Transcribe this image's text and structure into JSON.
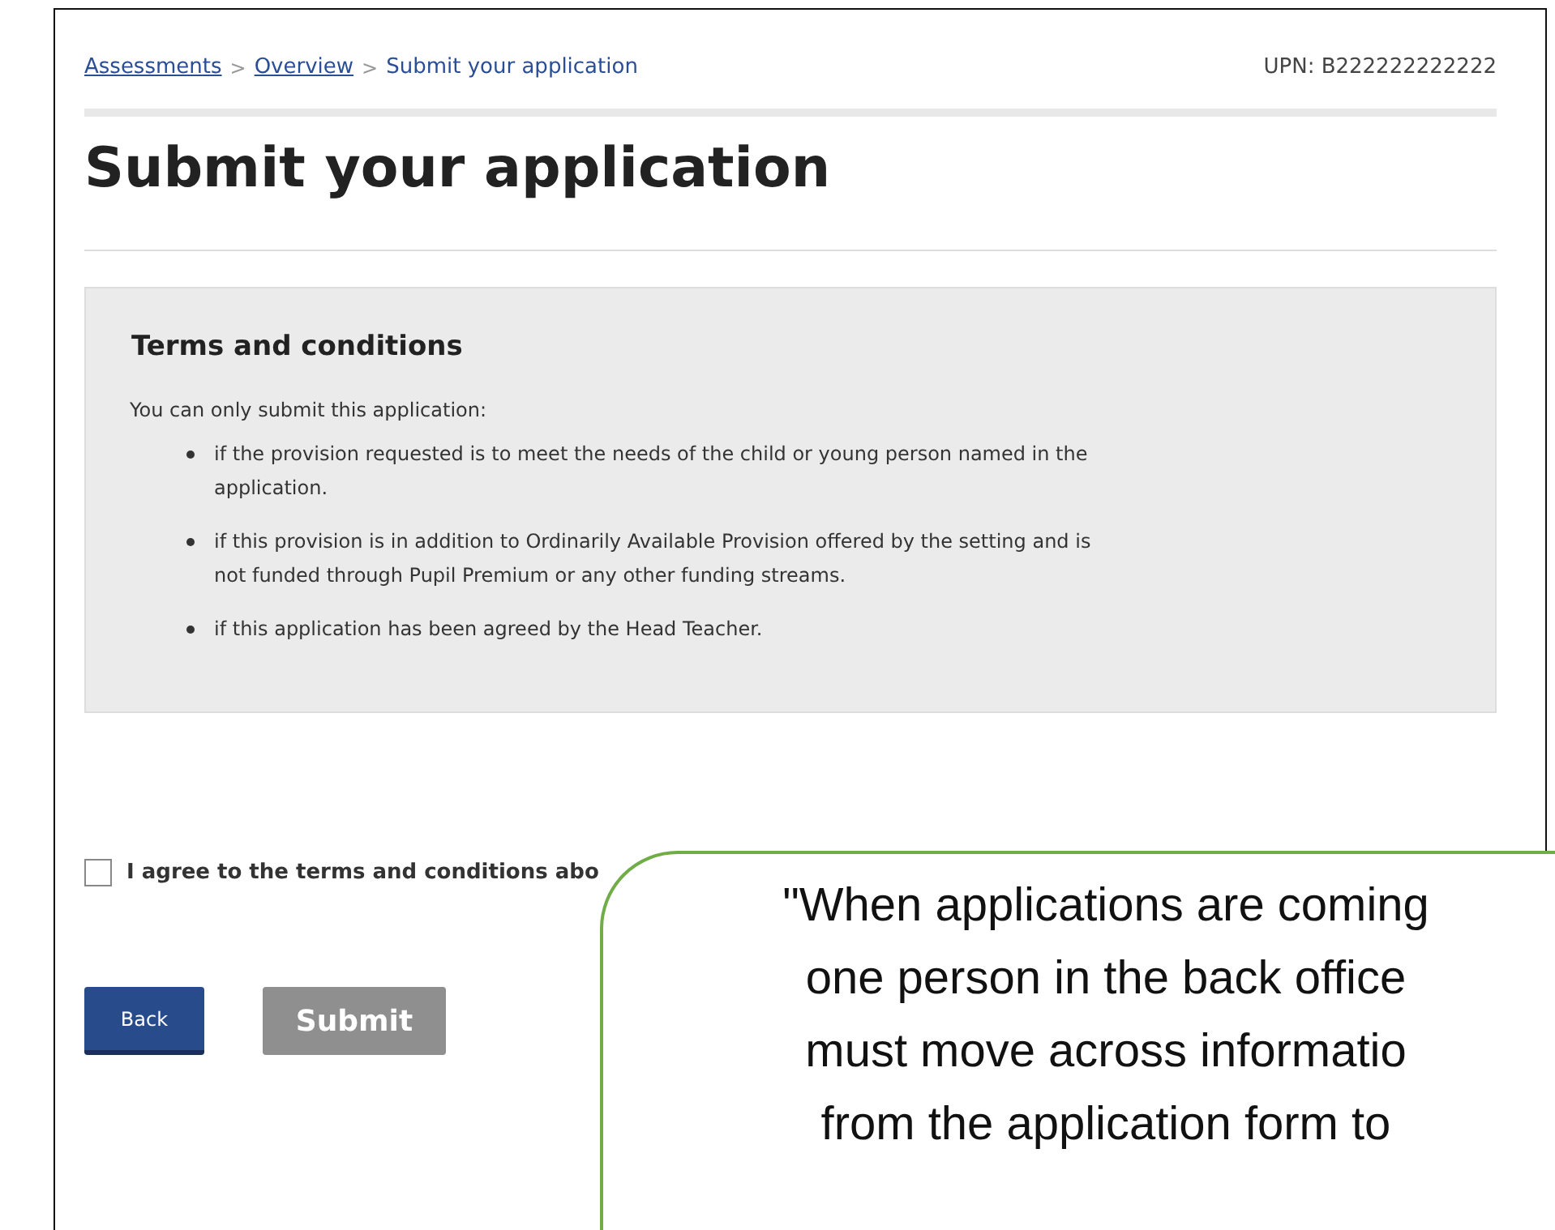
{
  "breadcrumbs": [
    {
      "label": "Assessments",
      "link": true
    },
    {
      "label": "Overview",
      "link": true
    },
    {
      "label": "Submit your application",
      "link": false
    }
  ],
  "separator": ">",
  "upn": "UPN: B222222222222",
  "title": "Submit your application",
  "terms": {
    "heading": "Terms and conditions",
    "intro": "You can only submit this application:",
    "items": [
      "if the provision requested is to meet the needs of the child or young person named in the application.",
      "if this provision is in addition to Ordinarily Available Provision offered by the setting and is not funded through Pupil Premium or any other funding streams.",
      "if this application has been agreed by the Head Teacher."
    ]
  },
  "agree": {
    "label": "I agree to the terms and conditions abo",
    "checked": false
  },
  "buttons": [
    {
      "label": "Back",
      "disabled": false
    },
    {
      "label": "Submit",
      "disabled": true
    }
  ],
  "callout": {
    "lines": [
      "\"When applications are coming",
      "one person in the back office",
      "must move across informatio",
      "from the application form to"
    ]
  }
}
